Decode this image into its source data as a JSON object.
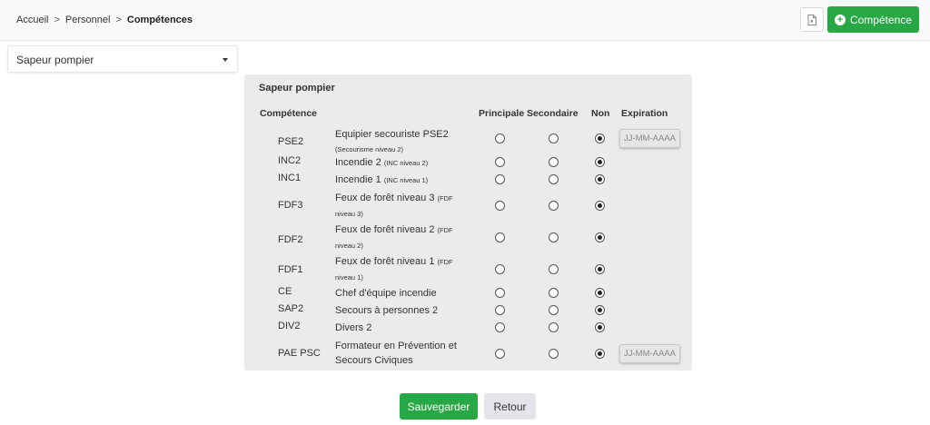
{
  "breadcrumb": {
    "items": [
      "Accueil",
      "Personnel",
      "Compétences"
    ],
    "separator": ">"
  },
  "header": {
    "export_icon": "file-export-icon",
    "add_button_label": "Compétence",
    "add_icon": "plus-circle-icon"
  },
  "role_select": {
    "value": "Sapeur pompier"
  },
  "panel": {
    "title": "Sapeur pompier",
    "columns": {
      "competence": "Compétence",
      "principale": "Principale",
      "secondaire": "Secondaire",
      "non": "Non",
      "expiration": "Expiration"
    },
    "rows": [
      {
        "code": "PSE2",
        "name": "Equipier secouriste PSE2",
        "sub": "(Secourisme niveau 2)",
        "selected": "non",
        "expiration_placeholder": "JJ-MM-AAAA"
      },
      {
        "code": "INC2",
        "name": "Incendie 2",
        "sub": "(INC niveau 2)",
        "selected": "non"
      },
      {
        "code": "INC1",
        "name": "Incendie 1",
        "sub": "(INC niveau 1)",
        "selected": "non"
      },
      {
        "code": "FDF3",
        "name": "Feux de forêt niveau 3",
        "sub": "(FDF niveau 3)",
        "selected": "non"
      },
      {
        "code": "FDF2",
        "name": "Feux de forêt niveau 2",
        "sub": "(FDF niveau 2)",
        "selected": "non"
      },
      {
        "code": "FDF1",
        "name": "Feux de forêt niveau 1",
        "sub": "(FDF niveau 1)",
        "selected": "non"
      },
      {
        "code": "CE",
        "name": "Chef d'équipe incendie",
        "sub": "",
        "selected": "non"
      },
      {
        "code": "SAP2",
        "name": "Secours à personnes 2",
        "sub": "",
        "selected": "non"
      },
      {
        "code": "DIV2",
        "name": "Divers 2",
        "sub": "",
        "selected": "non"
      },
      {
        "code": "PAE PSC",
        "name": "Formateur en Prévention et Secours Civiques",
        "sub": "",
        "selected": "non",
        "expiration_placeholder": "JJ-MM-AAAA"
      }
    ]
  },
  "footer": {
    "save_label": "Sauvegarder",
    "back_label": "Retour"
  },
  "colors": {
    "primary_green": "#28a745",
    "panel_bg": "#ebebeb",
    "topbar_bg": "#f8f9fa"
  }
}
